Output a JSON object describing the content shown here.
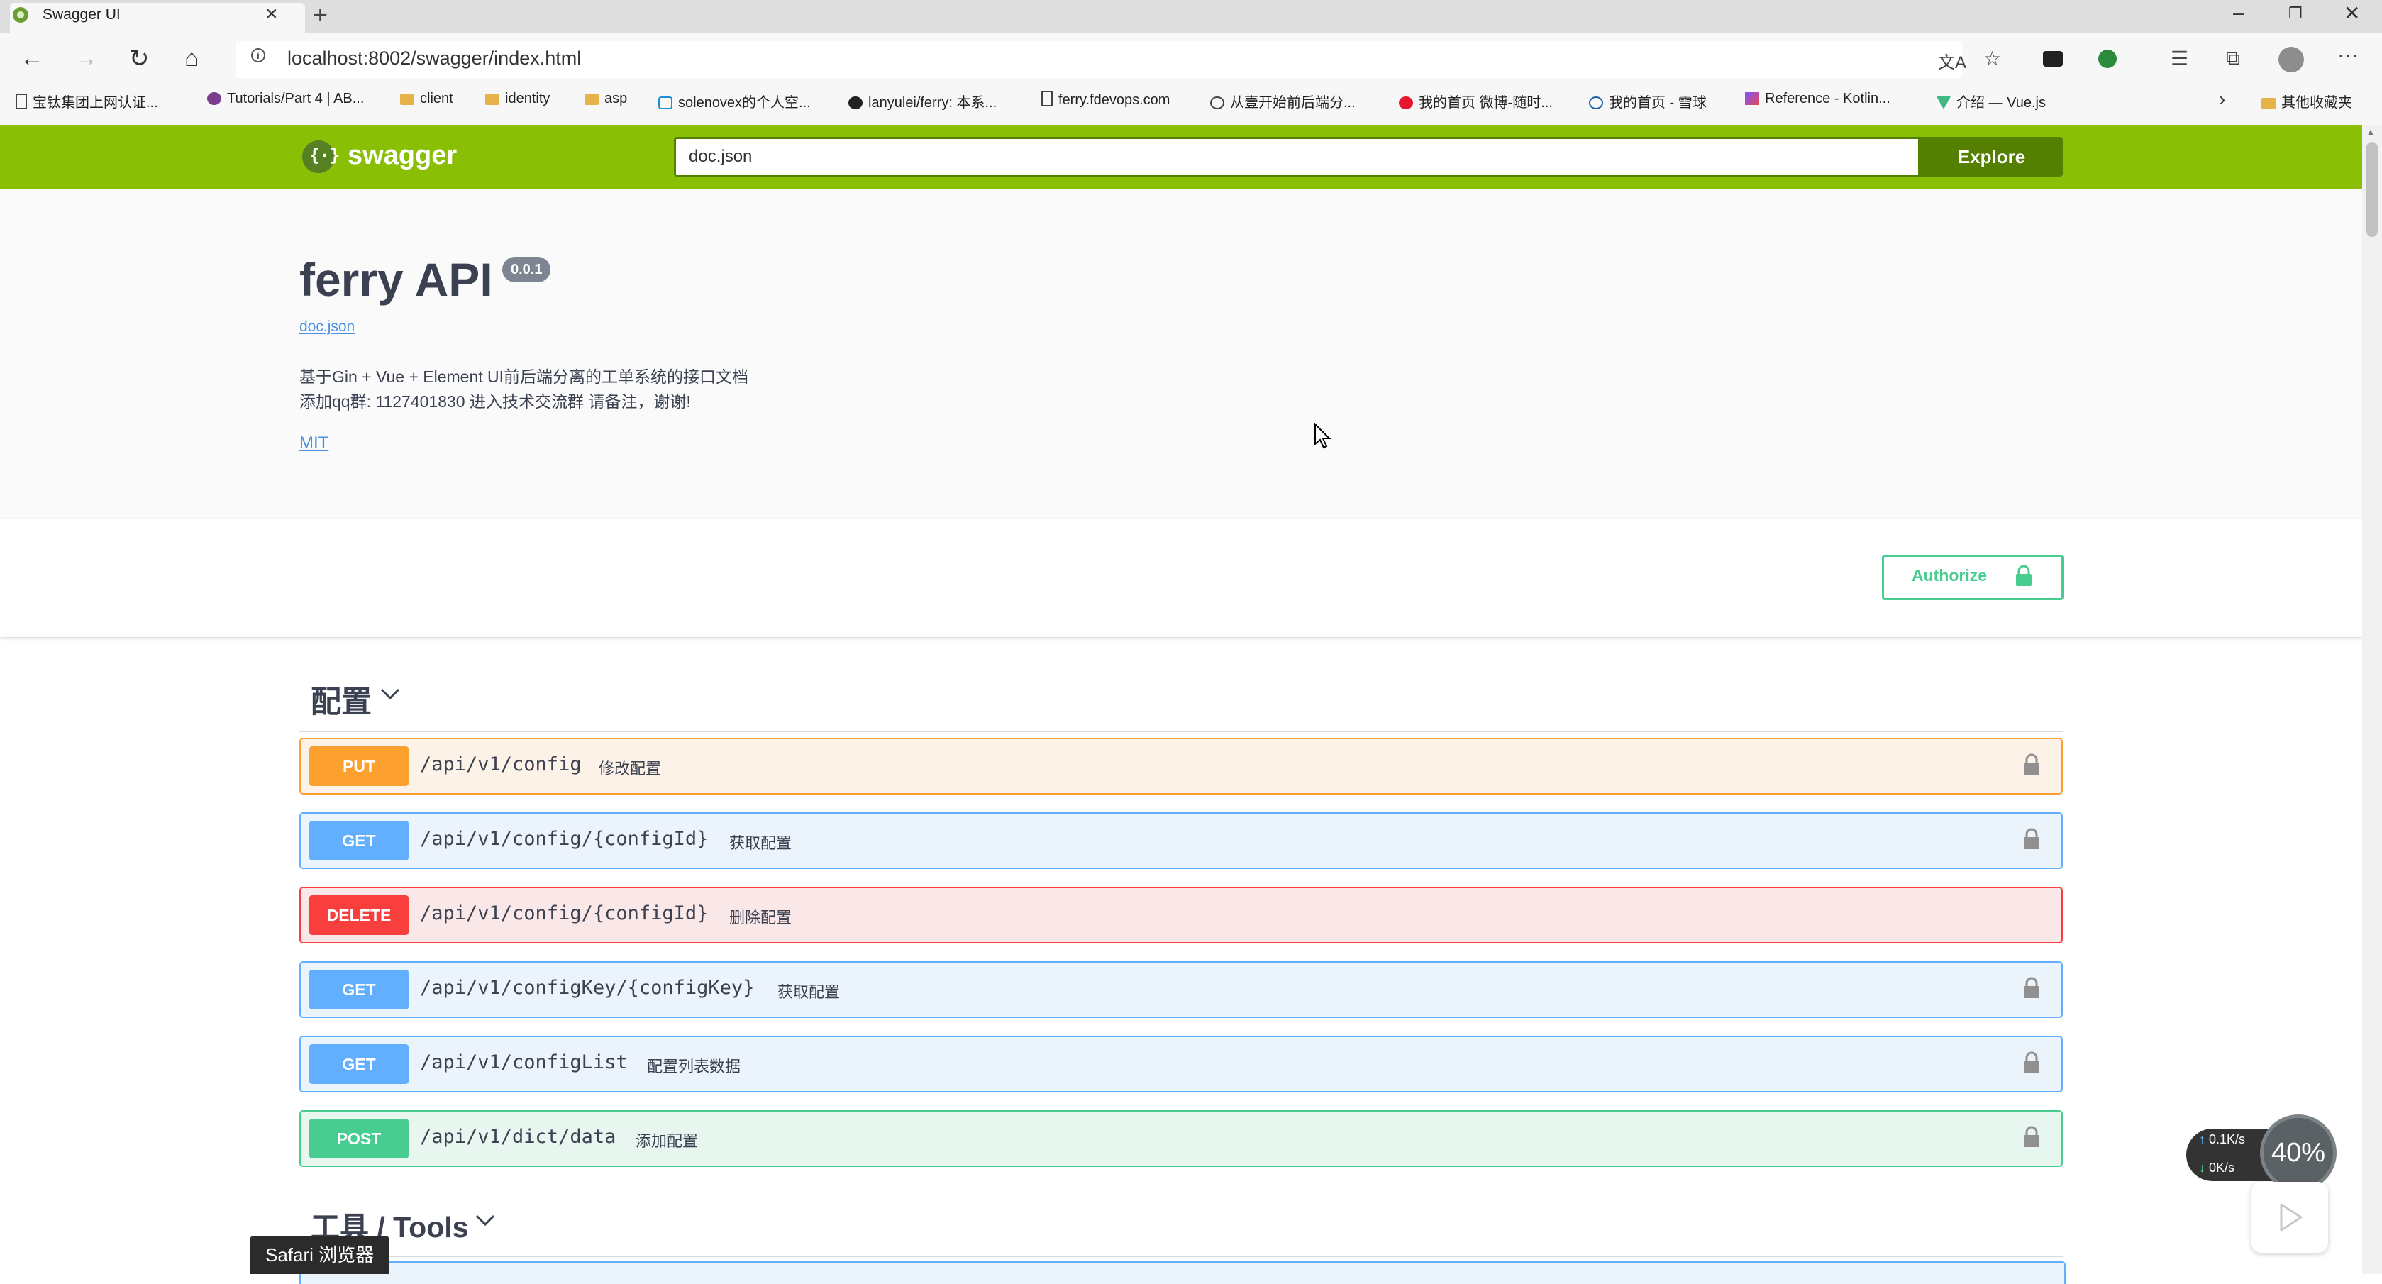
{
  "browser": {
    "tab_title": "Swagger UI",
    "tab_close": "×",
    "new_tab": "+",
    "url": "localhost:8002/swagger/index.html",
    "bookmarks": [
      {
        "label": "宝钛集团上网认证...",
        "icon": "page-icon"
      },
      {
        "label": "Tutorials/Part 4 | AB...",
        "icon": "site-icon"
      },
      {
        "label": "client",
        "icon": "folder-icon"
      },
      {
        "label": "identity",
        "icon": "folder-icon"
      },
      {
        "label": "asp",
        "icon": "folder-icon"
      },
      {
        "label": "solenovex的个人空...",
        "icon": "bilibili-icon"
      },
      {
        "label": "lanyulei/ferry: 本系...",
        "icon": "github-icon"
      },
      {
        "label": "ferry.fdevops.com",
        "icon": "page-icon"
      },
      {
        "label": "从壹开始前后端分...",
        "icon": "site-icon"
      },
      {
        "label": "我的首页 微博-随时...",
        "icon": "weibo-icon"
      },
      {
        "label": "我的首页 - 雪球",
        "icon": "xueqiu-icon"
      },
      {
        "label": "Reference - Kotlin...",
        "icon": "kotlin-icon"
      },
      {
        "label": "介绍 — Vue.js",
        "icon": "vue-icon"
      }
    ],
    "other_bookmarks": "其他收藏夹",
    "tooltip": "Safari 浏览器"
  },
  "swagger": {
    "logo_text": "swagger",
    "spec_url": "doc.json",
    "explore_label": "Explore",
    "api_title": "ferry API",
    "version": "0.0.1",
    "spec_link": "doc.json",
    "description_line1": "基于Gin + Vue + Element UI前后端分离的工单系统的接口文档",
    "description_line2": "添加qq群: 1127401830 进入技术交流群 请备注，谢谢!",
    "license": "MIT",
    "authorize_label": "Authorize"
  },
  "tags": [
    {
      "name": "配置",
      "operations": [
        {
          "method": "PUT",
          "path": "/api/v1/config",
          "summary": "修改配置"
        },
        {
          "method": "GET",
          "path": "/api/v1/config/{configId}",
          "summary": "获取配置"
        },
        {
          "method": "DELETE",
          "path": "/api/v1/config/{configId}",
          "summary": "删除配置"
        },
        {
          "method": "GET",
          "path": "/api/v1/configKey/{configKey}",
          "summary": "获取配置"
        },
        {
          "method": "GET",
          "path": "/api/v1/configList",
          "summary": "配置列表数据"
        },
        {
          "method": "POST",
          "path": "/api/v1/dict/data",
          "summary": "添加配置"
        }
      ]
    },
    {
      "name": "工具 / Tools",
      "operations": []
    }
  ],
  "overlay": {
    "upload_speed": "0.1K/s",
    "download_speed": "0K/s",
    "percent": "40%"
  },
  "colors": {
    "topbar": "#89bf04",
    "put": "#fca130",
    "get": "#61affe",
    "delete": "#f93e3e",
    "post": "#49cc90"
  }
}
